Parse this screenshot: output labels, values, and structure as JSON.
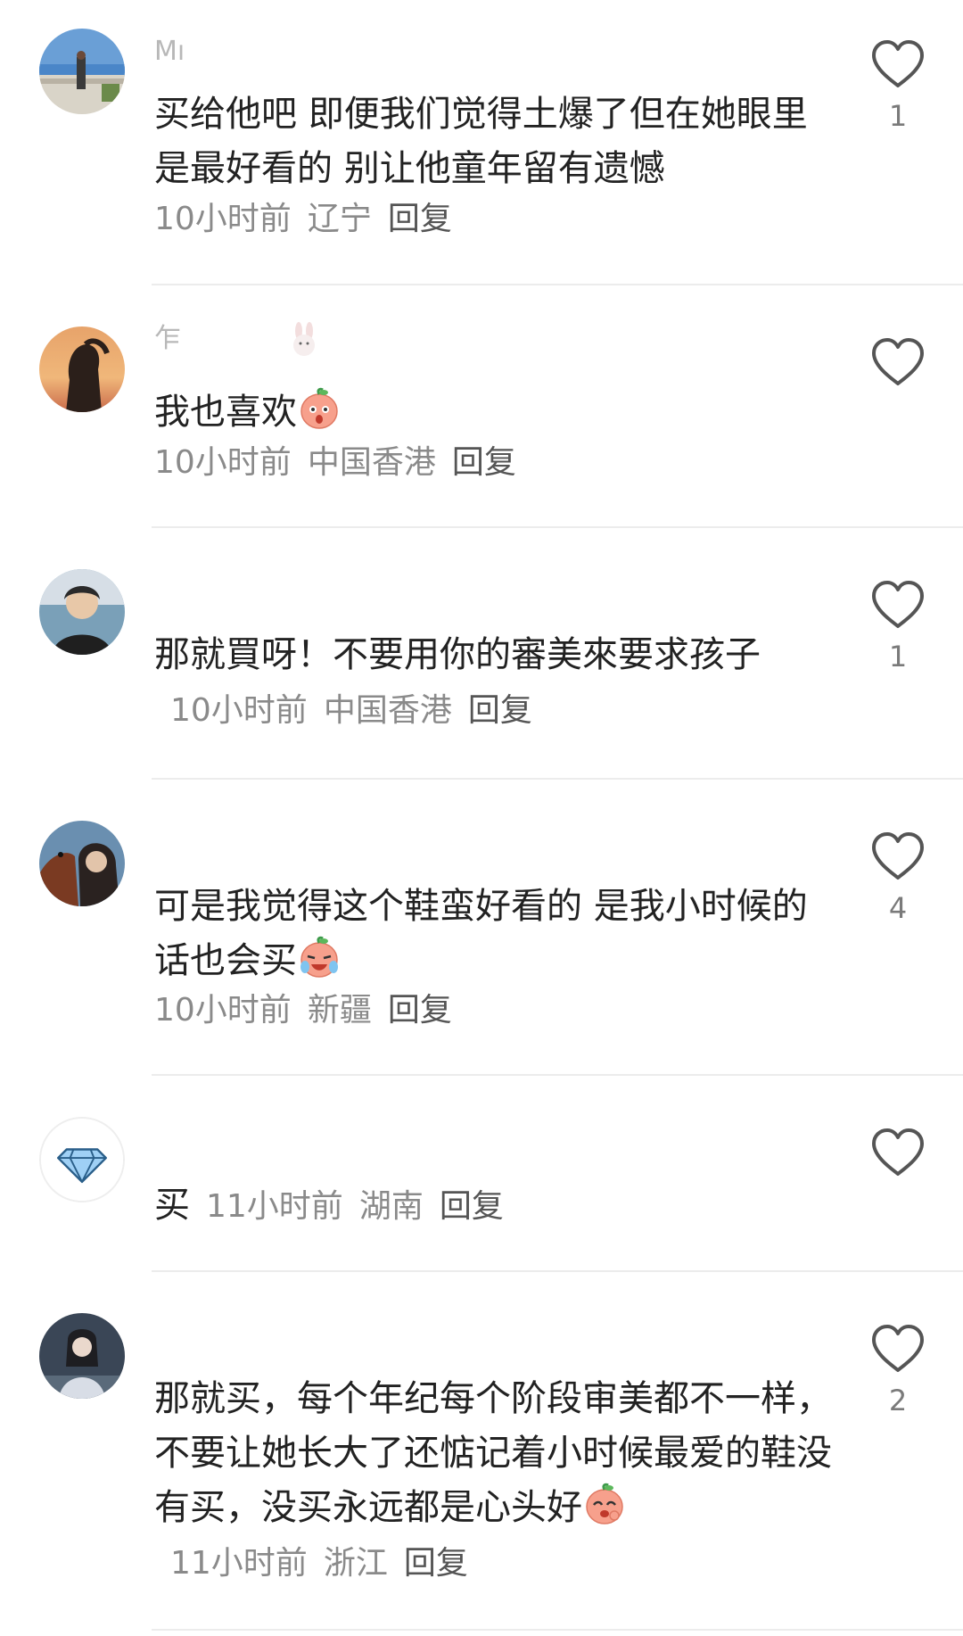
{
  "comments": [
    {
      "username": "Mı",
      "text": "买给他吧 即便我们觉得土爆了但在她眼里是最好看的 别让他童年留有遗憾",
      "time": "10小时前",
      "location": "辽宁",
      "reply": "回复",
      "likes": "1",
      "avatar": "beach-figure"
    },
    {
      "username": "乍",
      "text": "我也喜欢",
      "emoji": "surprised-peach-emoji",
      "time": "10小时前",
      "location": "中国香港",
      "reply": "回复",
      "likes": "",
      "avatar": "sunset-silhouette"
    },
    {
      "username": "",
      "text": "那就買呀！不要用你的審美來要求孩子",
      "time": "10小时前",
      "location": "中国香港",
      "reply": "回复",
      "likes": "1",
      "avatar": "woman-portrait"
    },
    {
      "username": "",
      "text": "可是我觉得这个鞋蛮好看的 是我小时候的话也会买",
      "emoji": "crying-laughing-peach-emoji",
      "time": "10小时前",
      "location": "新疆",
      "reply": "回复",
      "likes": "4",
      "avatar": "girl-with-horse"
    },
    {
      "username": "",
      "text": "买",
      "time": "11小时前",
      "location": "湖南",
      "reply": "回复",
      "likes": "",
      "avatar": "diamond"
    },
    {
      "username": "",
      "text": "那就买，每个年纪每个阶段审美都不一样，不要让她长大了还惦记着小时候最爱的鞋没有买，没买永远都是心头好",
      "emoji": "shy-peach-emoji",
      "time": "11小时前",
      "location": "浙江",
      "reply": "回复",
      "likes": "2",
      "avatar": "costume-figure"
    }
  ],
  "colors": {
    "text": "#222222",
    "meta": "#8a8a8a",
    "heart": "#555555",
    "divider": "#ececec",
    "peach": "#f7a08c"
  }
}
